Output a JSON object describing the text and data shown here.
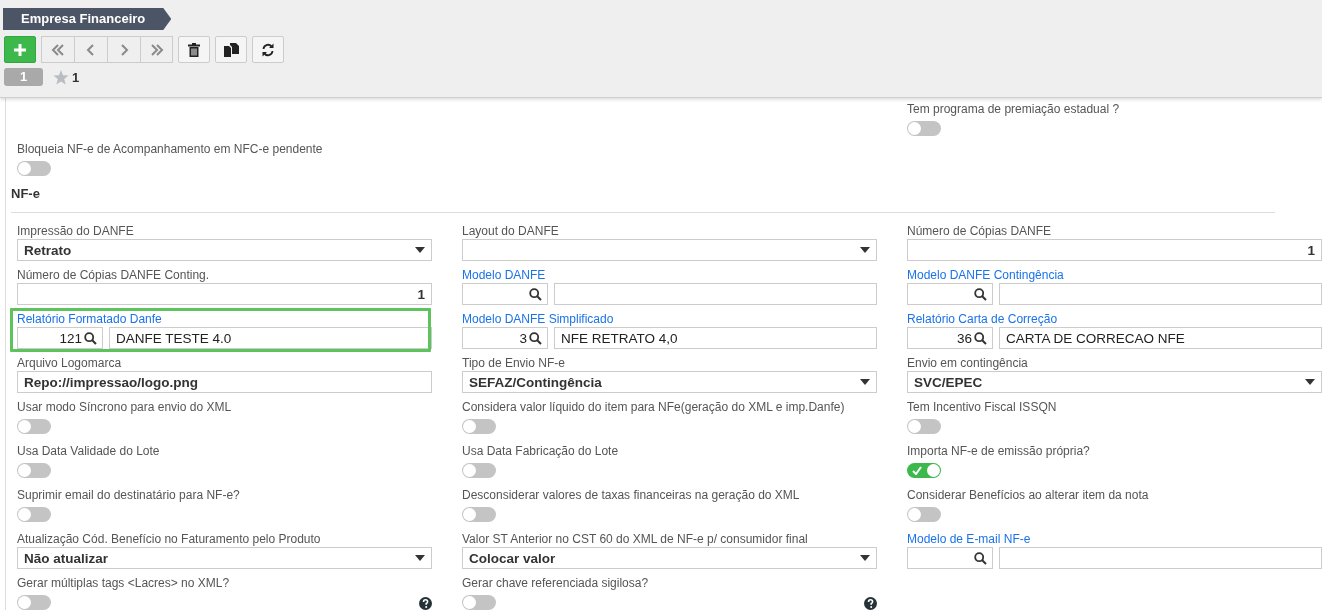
{
  "header": {
    "title": "Empresa Financeiro",
    "record_tab": "1",
    "favorites_count": "1"
  },
  "top_fields": [
    {
      "kind": "blank"
    },
    {
      "kind": "blank"
    },
    {
      "kind": "toggle",
      "label": "Tem programa de premiação estadual ?",
      "on": false
    },
    {
      "kind": "toggle",
      "label": "Bloqueia NF-e de Acompanhamento em NFC-e pendente",
      "on": false
    }
  ],
  "section": {
    "title": "NF-e"
  },
  "fields": [
    {
      "kind": "select",
      "label": "Impressão do DANFE",
      "value": "Retrato"
    },
    {
      "kind": "select",
      "label": "Layout do DANFE"
    },
    {
      "kind": "number",
      "label": "Número de Cópias DANFE",
      "value": "1"
    },
    {
      "kind": "number",
      "label": "Número de Cópias DANFE Conting.",
      "value": "1"
    },
    {
      "kind": "lookup",
      "label": "Modelo DANFE",
      "link": true
    },
    {
      "kind": "lookup",
      "label": "Modelo DANFE Contingência",
      "link": true
    },
    {
      "kind": "lookup",
      "label": "Relatório Formatado Danfe",
      "link": true,
      "highlighted": true,
      "code": "121",
      "description": "DANFE TESTE 4.0"
    },
    {
      "kind": "lookup",
      "label": "Modelo DANFE Simplificado",
      "link": true,
      "code": "3",
      "description": "NFE RETRATO 4,0"
    },
    {
      "kind": "lookup",
      "label": "Relatório Carta de Correção",
      "link": true,
      "code": "36",
      "description": "CARTA DE CORRECAO NFE"
    },
    {
      "kind": "text",
      "label": "Arquivo Logomarca",
      "value": "Repo://impressao/logo.png"
    },
    {
      "kind": "select",
      "label": "Tipo de Envio NF-e",
      "value": "SEFAZ/Contingência"
    },
    {
      "kind": "select",
      "label": "Envio em contingência",
      "value": "SVC/EPEC"
    },
    {
      "kind": "toggle",
      "label": "Usar modo Síncrono para envio do XML",
      "on": false
    },
    {
      "kind": "toggle",
      "label": "Considera valor líquido do item para NFe(geração do XML e imp.Danfe)",
      "on": false
    },
    {
      "kind": "toggle",
      "label": "Tem Incentivo Fiscal ISSQN",
      "on": false
    },
    {
      "kind": "toggle",
      "label": "Usa Data Validade do Lote",
      "on": false
    },
    {
      "kind": "toggle",
      "label": "Usa Data Fabricação do Lote",
      "on": false
    },
    {
      "kind": "toggle",
      "label": "Importa NF-e de emissão própria?",
      "on": true
    },
    {
      "kind": "toggle",
      "label": "Suprimir email do destinatário para NF-e?",
      "on": false
    },
    {
      "kind": "toggle",
      "label": "Desconsiderar valores de taxas financeiras na geração do XML",
      "on": false
    },
    {
      "kind": "toggle",
      "label": "Considerar Benefícios ao alterar item da nota",
      "on": false
    },
    {
      "kind": "select",
      "label": "Atualização Cód. Benefício no Faturamento pelo Produto",
      "value": "Não atualizar"
    },
    {
      "kind": "select",
      "label": "Valor ST Anterior no CST 60 do XML de NF-e p/ consumidor final",
      "value": "Colocar valor"
    },
    {
      "kind": "lookup",
      "label": "Modelo de E-mail NF-e",
      "link": true
    },
    {
      "kind": "toggle",
      "label": "Gerar múltiplas tags <Lacres> no XML?",
      "on": false,
      "help": true
    },
    {
      "kind": "toggle",
      "label": "Gerar chave referenciada sigilosa?",
      "on": false,
      "help": true
    }
  ]
}
